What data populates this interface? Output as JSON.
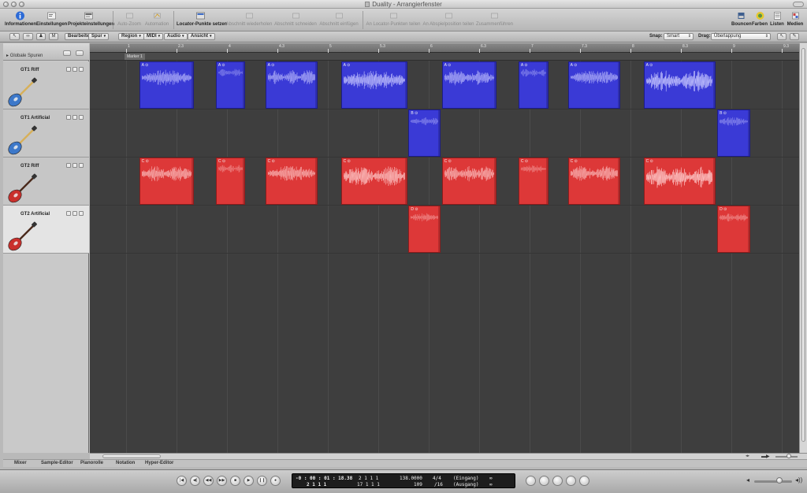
{
  "window": {
    "title": "Duality - Arrangierfenster"
  },
  "toolbar": {
    "left": [
      {
        "label": "Informationen",
        "icon": "info-icon"
      },
      {
        "label": "Einstellungen",
        "icon": "settings-icon"
      },
      {
        "label": "Projekteinstellungen",
        "icon": "project-settings-icon"
      }
    ],
    "middle": [
      {
        "label": "Auto-Zoom",
        "icon": "zoom-icon",
        "enabled": false
      },
      {
        "label": "Automation",
        "icon": "automation-icon",
        "enabled": false
      },
      {
        "label": "Locator-Punkte setzen",
        "icon": "locator-icon",
        "enabled": true
      },
      {
        "label": "Abschnitt wiederholen",
        "icon": "repeat-section-icon",
        "enabled": false
      },
      {
        "label": "Abschnitt schneiden",
        "icon": "cut-section-icon",
        "enabled": false
      },
      {
        "label": "Abschnitt einfügen",
        "icon": "insert-section-icon",
        "enabled": false
      },
      {
        "label": "An Locator-Punkten teilen",
        "icon": "split-locators-icon",
        "enabled": false
      },
      {
        "label": "An Abspielposition teilen",
        "icon": "split-playhead-icon",
        "enabled": false
      },
      {
        "label": "Zusammenführen",
        "icon": "merge-icon",
        "enabled": false
      }
    ],
    "right": [
      {
        "label": "Bouncen",
        "icon": "bounce-icon"
      },
      {
        "label": "Farben",
        "icon": "colors-icon"
      },
      {
        "label": "Listen",
        "icon": "lists-icon"
      },
      {
        "label": "Medien",
        "icon": "media-icon"
      }
    ]
  },
  "subbar": {
    "menus": [
      "Bearbeiten",
      "Spur",
      "Region",
      "MIDI",
      "Audio",
      "Ansicht"
    ],
    "snap_label": "Snap:",
    "snap_value": "Smart",
    "drag_label": "Drag:",
    "drag_value": "Überlappung"
  },
  "global_tracks_label": "Globale Spuren",
  "tracks": [
    {
      "name": "GT1 Riff",
      "color": "blue",
      "selected": false
    },
    {
      "name": "GT1 Artificial",
      "color": "blue",
      "selected": false
    },
    {
      "name": "GT2 Riff",
      "color": "red",
      "selected": false
    },
    {
      "name": "GT2 Artificial",
      "color": "red",
      "selected": true
    }
  ],
  "ruler": {
    "marks": [
      {
        "label": "1"
      },
      {
        "label": "2.3"
      },
      {
        "label": "4"
      },
      {
        "label": "4.3"
      },
      {
        "label": "5"
      },
      {
        "label": "5.3"
      },
      {
        "label": "6"
      },
      {
        "label": "6.3"
      },
      {
        "label": "7"
      },
      {
        "label": "7.3"
      },
      {
        "label": "8"
      },
      {
        "label": "8.3"
      },
      {
        "label": "9"
      },
      {
        "label": "9.3"
      }
    ],
    "marker": "Marker 1"
  },
  "regions": [
    {
      "track": 0,
      "start": 1.13,
      "len": 0.54,
      "label": "A ⊙"
    },
    {
      "track": 0,
      "start": 1.89,
      "len": 0.29,
      "label": "A ⊙"
    },
    {
      "track": 0,
      "start": 2.38,
      "len": 0.52,
      "label": "A ⊙"
    },
    {
      "track": 0,
      "start": 3.13,
      "len": 0.66,
      "label": "A ⊙"
    },
    {
      "track": 0,
      "start": 4.13,
      "len": 0.54,
      "label": "A ⊙"
    },
    {
      "track": 0,
      "start": 4.89,
      "len": 0.3,
      "label": "A ⊙"
    },
    {
      "track": 0,
      "start": 5.38,
      "len": 0.52,
      "label": "A ⊙"
    },
    {
      "track": 0,
      "start": 6.13,
      "len": 0.71,
      "label": "A ⊙"
    },
    {
      "track": 1,
      "start": 3.8,
      "len": 0.32,
      "label": "B ⊙"
    },
    {
      "track": 1,
      "start": 6.86,
      "len": 0.33,
      "label": "B ⊙"
    },
    {
      "track": 2,
      "start": 1.13,
      "len": 0.54,
      "label": "C ⊙"
    },
    {
      "track": 2,
      "start": 1.89,
      "len": 0.29,
      "label": "C ⊙"
    },
    {
      "track": 2,
      "start": 2.38,
      "len": 0.52,
      "label": "C ⊙"
    },
    {
      "track": 2,
      "start": 3.13,
      "len": 0.66,
      "label": "C ⊙"
    },
    {
      "track": 2,
      "start": 4.13,
      "len": 0.54,
      "label": "C ⊙"
    },
    {
      "track": 2,
      "start": 4.89,
      "len": 0.3,
      "label": "C ⊙"
    },
    {
      "track": 2,
      "start": 5.38,
      "len": 0.52,
      "label": "C ⊙"
    },
    {
      "track": 2,
      "start": 6.13,
      "len": 0.71,
      "label": "C ⊙"
    },
    {
      "track": 3,
      "start": 3.8,
      "len": 0.32,
      "label": "D ⊙"
    },
    {
      "track": 3,
      "start": 6.86,
      "len": 0.33,
      "label": "D ⊙"
    }
  ],
  "bottom_tabs": [
    "Mixer",
    "Sample-Editor",
    "Pianorolle",
    "Notation",
    "Hyper-Editor"
  ],
  "transport": {
    "buttons": [
      "go-to-start",
      "rewind-step",
      "rewind",
      "fast-forward",
      "stop",
      "play",
      "pause",
      "record"
    ],
    "smpte": "-0 : 00 : 01 : 18.38",
    "bars": "2  1  1  1",
    "bars_end": "2  1  1  1",
    "position_top": "2   1   1   1",
    "position_bottom": "17   1   1   1",
    "tempo": "138.0000",
    "tempo_bottom": "109",
    "signature": "4/4",
    "division": "/16",
    "input_label": "(Eingang)",
    "output_label": "(Ausgang)",
    "input_symbol": "∞",
    "output_symbol": "∞",
    "right_buttons": [
      "cycle-icon",
      "replace-icon",
      "solo-icon",
      "sync-icon",
      "metronome-icon"
    ]
  },
  "colors": {
    "blue_region": "#3a3ad6",
    "red_region": "#dd3838",
    "arrange_bg": "#3e3e3e"
  }
}
